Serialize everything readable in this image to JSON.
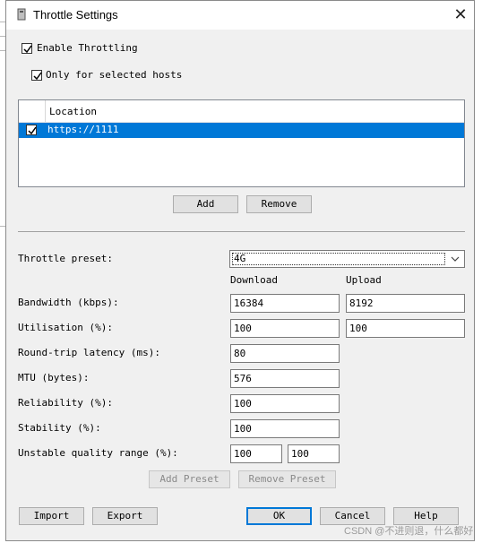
{
  "window": {
    "title": "Throttle Settings",
    "close_glyph": "✕"
  },
  "enable_throttling": {
    "label": "Enable Throttling",
    "checked": true
  },
  "only_selected_hosts": {
    "label": "Only for selected hosts",
    "checked": true
  },
  "hosts_table": {
    "column_header": "Location",
    "rows": [
      {
        "checked": true,
        "location": "https://1111",
        "selected": true
      }
    ]
  },
  "host_buttons": {
    "add": "Add",
    "remove": "Remove"
  },
  "preset": {
    "label": "Throttle preset:",
    "value": "4G"
  },
  "columns": {
    "download": "Download",
    "upload": "Upload"
  },
  "settings": {
    "bandwidth": {
      "label": "Bandwidth (kbps):",
      "download": "16384",
      "upload": "8192"
    },
    "utilisation": {
      "label": "Utilisation (%):",
      "download": "100",
      "upload": "100"
    },
    "latency": {
      "label": "Round-trip latency (ms):",
      "value": "80"
    },
    "mtu": {
      "label": "MTU (bytes):",
      "value": "576"
    },
    "reliability": {
      "label": "Reliability (%):",
      "value": "100"
    },
    "stability": {
      "label": "Stability (%):",
      "value": "100"
    },
    "unstable_range": {
      "label": "Unstable quality range (%):",
      "low": "100",
      "high": "100"
    }
  },
  "preset_buttons": {
    "add": "Add Preset",
    "remove": "Remove Preset"
  },
  "footer_buttons": {
    "import": "Import",
    "export": "Export",
    "ok": "OK",
    "cancel": "Cancel",
    "help": "Help"
  },
  "watermark": "CSDN @不进则退，什么都好",
  "colors": {
    "selection": "#0078d7",
    "dialog_bg": "#f0f0f0"
  }
}
